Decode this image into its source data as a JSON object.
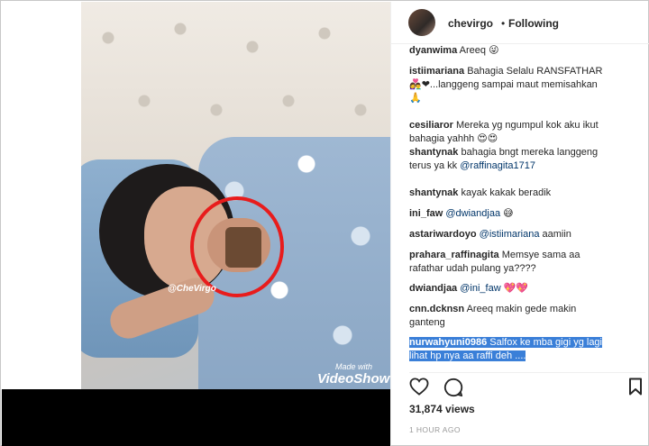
{
  "post": {
    "username": "chevirgo",
    "separator": "•",
    "follow_status": "Following",
    "likes": "31,874 views",
    "time_ago": "1 HOUR AGO"
  },
  "media": {
    "watermark": "@CheVirgo",
    "made_with": "Made with",
    "brand": "VideoShow"
  },
  "comments": [
    {
      "user": "dyanwima",
      "parts": [
        {
          "t": "Areeq "
        },
        {
          "e": "😜"
        }
      ]
    },
    {
      "user": "istiimariana",
      "parts": [
        {
          "t": "Bahagia Selalu RANSFATHAR"
        }
      ],
      "line2": [
        {
          "e": "👩‍❤️‍👨"
        },
        {
          "t": "❤"
        },
        {
          "t": "...langgeng sampai maut memisahkan"
        }
      ],
      "line3": [
        {
          "e": "🙏"
        }
      ]
    },
    {
      "user": "cesiliaror",
      "parts": [
        {
          "t": "Mereka yg ngumpul kok aku ikut"
        }
      ],
      "line2": [
        {
          "t": "bahagia yahhh "
        },
        {
          "e": "😍😍"
        }
      ]
    },
    {
      "user": "shantynak",
      "parts": [
        {
          "t": "bahagia bngt mereka langgeng"
        }
      ],
      "line2": [
        {
          "t": "terus ya kk "
        },
        {
          "m": "@raffinagita1717"
        }
      ]
    },
    {
      "user": "shantynak",
      "parts": [
        {
          "t": "kayak kakak beradik"
        }
      ]
    },
    {
      "user": "ini_faw",
      "parts": [
        {
          "m": "@dwiandjaa"
        },
        {
          "t": " "
        },
        {
          "e": "😅"
        }
      ]
    },
    {
      "user": "astariwardoyo",
      "parts": [
        {
          "m": "@istiimariana"
        },
        {
          "t": " aamiin"
        }
      ]
    },
    {
      "user": "prahara_raffinagita",
      "parts": [
        {
          "t": "Memsye sama aa"
        }
      ],
      "line2": [
        {
          "t": "rafathar udah pulang ya????"
        }
      ]
    },
    {
      "user": "dwiandjaa",
      "parts": [
        {
          "m": "@ini_faw"
        },
        {
          "t": " "
        },
        {
          "e": "💖💖"
        }
      ]
    },
    {
      "user": "cnn.dcknsn",
      "parts": [
        {
          "t": "Areeq makin gede makin"
        }
      ],
      "line2": [
        {
          "t": "ganteng"
        }
      ]
    },
    {
      "user": "nurwahyuni0986",
      "highlighted": true,
      "parts": [
        {
          "t": "Salfox ke mba gigi yg lagi"
        }
      ],
      "line2": [
        {
          "t": "lihat hp nya aa raffi deh ...."
        }
      ]
    }
  ],
  "icons": [
    "heart-icon",
    "comment-icon",
    "bookmark-icon"
  ],
  "colors": {
    "highlight": "#3a7fd8",
    "mention": "#003569",
    "circle": "#e81c1c"
  }
}
